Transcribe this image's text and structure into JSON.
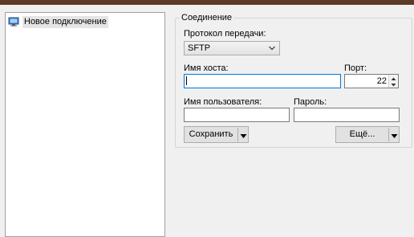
{
  "site_tree": {
    "items": [
      {
        "label": "Новое подключение",
        "icon": "computer-icon",
        "selected": true
      }
    ]
  },
  "connection": {
    "group_title": "Соединение",
    "protocol": {
      "label": "Протокол передачи:",
      "value": "SFTP"
    },
    "host": {
      "label": "Имя хоста:",
      "value": ""
    },
    "port": {
      "label": "Порт:",
      "value": "22"
    },
    "username": {
      "label": "Имя пользователя:",
      "value": ""
    },
    "password": {
      "label": "Пароль:",
      "value": ""
    },
    "save_button": "Сохранить",
    "more_button": "Ещё..."
  },
  "colors": {
    "titlebar": "#5c3a26",
    "focus_border": "#0078d7",
    "selection_bg": "#e5e5e5"
  }
}
